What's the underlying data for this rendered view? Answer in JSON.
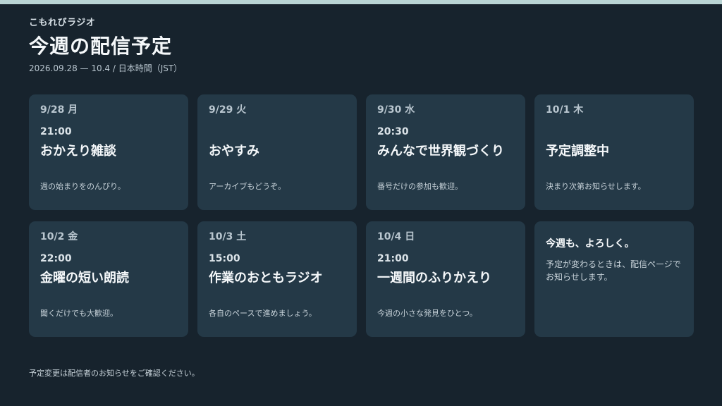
{
  "header": {
    "brand": "こもれびラジオ",
    "title": "今週の配信予定",
    "subtitle": "2026.09.28 — 10.4 / 日本時間（JST）"
  },
  "schedule": [
    {
      "day": "9/28 月",
      "time": "21:00",
      "name": "おかえり雑談",
      "desc": "週の始まりをのんびり。"
    },
    {
      "day": "9/29 火",
      "time": "",
      "name": "おやすみ",
      "desc": "アーカイブもどうぞ。"
    },
    {
      "day": "9/30 水",
      "time": "20:30",
      "name": "みんなで世界観づくり",
      "desc": "番号だけの参加も歓迎。"
    },
    {
      "day": "10/1 木",
      "time": "",
      "name": "予定調整中",
      "desc": "決まり次第お知らせします。"
    },
    {
      "day": "10/2 金",
      "time": "22:00",
      "name": "金曜の短い朗読",
      "desc": "聞くだけでも大歓迎。"
    },
    {
      "day": "10/3 土",
      "time": "15:00",
      "name": "作業のおともラジオ",
      "desc": "各自のペースで進めましょう。"
    },
    {
      "day": "10/4 日",
      "time": "21:00",
      "name": "一週間のふりかえり",
      "desc": "今週の小さな発見をひとつ。"
    }
  ],
  "note": {
    "title": "今週も、よろしく。",
    "text": "予定が変わるときは、配信ページでお知らせします。"
  },
  "footer": {
    "text": "予定変更は配信者のお知らせをご確認ください。"
  },
  "colors": {
    "background": "#17232d",
    "card": "#243947",
    "accent_bar": "#b9d4d4"
  }
}
